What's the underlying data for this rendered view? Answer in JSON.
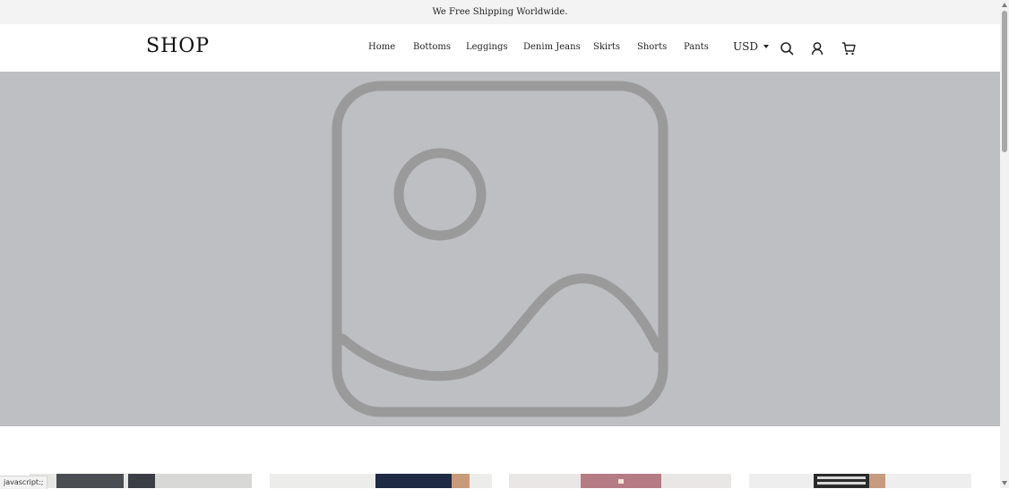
{
  "announcement": "We Free Shipping Worldwide.",
  "header": {
    "logo": "SHOP",
    "nav": [
      "Home",
      "Bottoms",
      "Leggings",
      "Denim Jeans",
      "Skirts",
      "Shorts",
      "Pants"
    ],
    "currency": "USD",
    "icons": [
      "search-icon",
      "account-icon",
      "cart-icon"
    ]
  },
  "hero": {
    "icon": "image-placeholder-icon",
    "background": "#bebfc2",
    "stroke": "#9a9a9a"
  },
  "status_bar": "javascript:;",
  "colors": {
    "announcement_bg": "#f3f3f3",
    "text": "#222222"
  }
}
